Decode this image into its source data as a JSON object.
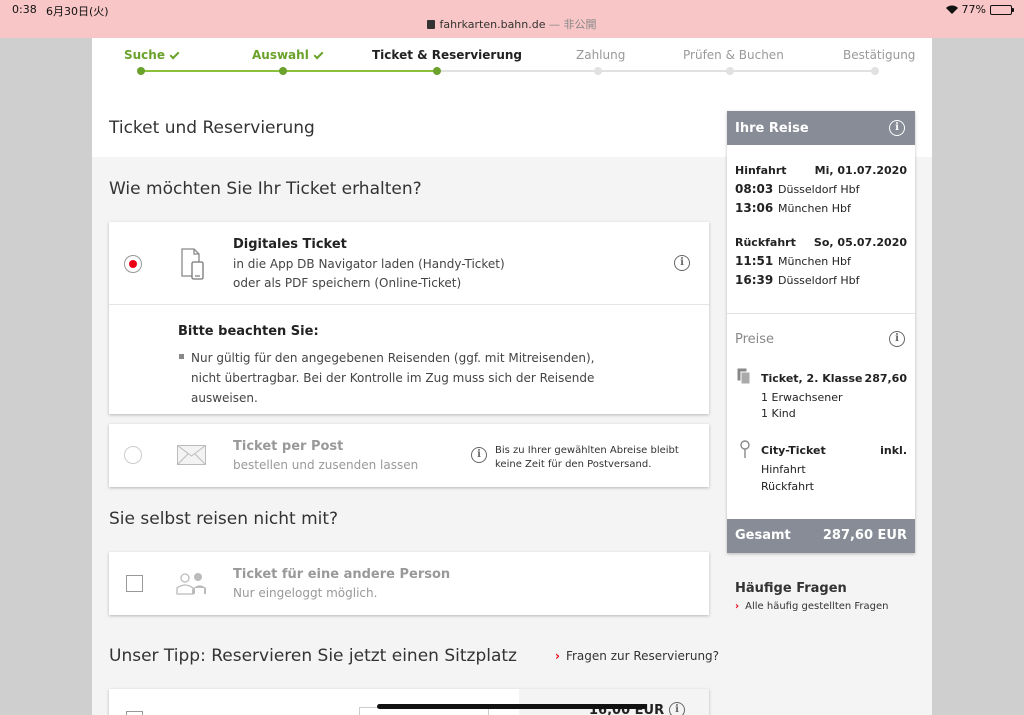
{
  "status_bar": {
    "time": "0:38",
    "date": "6月30日(火)",
    "url": "fahrkarten.bahn.de",
    "url_suffix": "— 非公開",
    "battery": "77%"
  },
  "stepper": {
    "steps": [
      {
        "label": "Suche",
        "state": "done"
      },
      {
        "label": "Auswahl",
        "state": "done"
      },
      {
        "label": "Ticket & Reservierung",
        "state": "active"
      },
      {
        "label": "Zahlung",
        "state": "todo"
      },
      {
        "label": "Prüfen & Buchen",
        "state": "todo"
      },
      {
        "label": "Bestätigung",
        "state": "todo"
      }
    ]
  },
  "main": {
    "section_title": "Ticket und Reservierung",
    "delivery_heading": "Wie möchten Sie Ihr Ticket erhalten?",
    "digital": {
      "title": "Digitales Ticket",
      "line1": "in die App DB Navigator laden (Handy-Ticket)",
      "line2": "oder als PDF speichern (Online-Ticket)",
      "note_title": "Bitte beachten Sie:",
      "note_text": "Nur gültig für den angegebenen Reisenden (ggf. mit Mitreisenden), nicht übertragbar. Bei der Kontrolle im Zug muss sich der Reisende ausweisen."
    },
    "post": {
      "title": "Ticket per Post",
      "subtitle": "bestellen und zusenden lassen",
      "hint": "Bis zu Ihrer gewählten Abreise bleibt keine Zeit für den Postversand."
    },
    "other_heading": "Sie selbst reisen nicht mit?",
    "other": {
      "title": "Ticket für eine andere Person",
      "subtitle": "Nur eingeloggt möglich."
    },
    "tip_heading": "Unser Tipp: Reservieren Sie jetzt einen Sitzplatz",
    "tip_link": "Fragen zur Reservierung?",
    "reserve_price": "16,00 EUR"
  },
  "sidebar": {
    "title": "Ihre Reise",
    "outbound": {
      "label": "Hinfahrt",
      "date": "Mi, 01.07.2020",
      "dep_time": "08:03",
      "dep_station": "Düsseldorf Hbf",
      "arr_time": "13:06",
      "arr_station": "München Hbf"
    },
    "return": {
      "label": "Rückfahrt",
      "date": "So, 05.07.2020",
      "dep_time": "11:51",
      "dep_station": "München Hbf",
      "arr_time": "16:39",
      "arr_station": "Düsseldorf Hbf"
    },
    "prices_title": "Preise",
    "ticket": {
      "label": "Ticket, 2. Klasse",
      "price": "287,60",
      "line1": "1 Erwachsener",
      "line2": "1 Kind"
    },
    "city": {
      "label": "City-Ticket",
      "price": "inkl.",
      "line1": "Hinfahrt",
      "line2": "Rückfahrt"
    },
    "total_label": "Gesamt",
    "total_value": "287,60 EUR"
  },
  "faq": {
    "title": "Häufige Fragen",
    "link": "Alle häufig gestellten Fragen"
  },
  "colors": {
    "accent_red": "#ec0016",
    "progress_green": "#6aa22b",
    "sidebar_gray": "#878c96"
  }
}
